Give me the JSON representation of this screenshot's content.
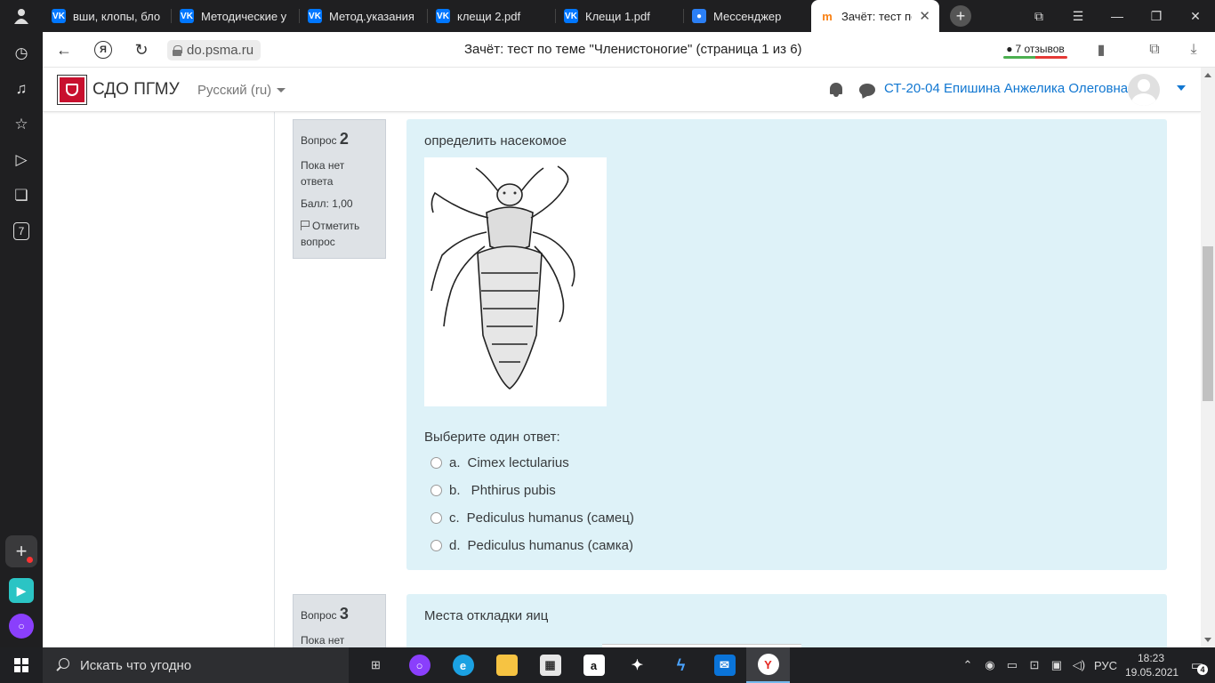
{
  "browser": {
    "tabs": [
      {
        "title": "вши, клопы, бло",
        "icon": "vk-icon",
        "active": false
      },
      {
        "title": "Методические у",
        "icon": "vk-icon",
        "active": false
      },
      {
        "title": "Метод.указания",
        "icon": "vk-icon",
        "active": false
      },
      {
        "title": "клещи 2.pdf",
        "icon": "vk-icon",
        "active": false
      },
      {
        "title": "Клещи 1.pdf",
        "icon": "vk-icon",
        "active": false
      },
      {
        "title": "Мессенджер",
        "icon": "messenger-icon",
        "active": false
      },
      {
        "title": "Зачёт: тест по",
        "icon": "moodle-icon",
        "active": true
      }
    ],
    "url": "do.psma.ru",
    "page_title": "Зачёт: тест по теме \"Членистоногие\" (страница 1 из 6)",
    "reviews_label": "7 отзывов",
    "sidebar_badge": "7"
  },
  "moodle": {
    "site_name": "СДО ПГМУ",
    "language": "Русский (ru)",
    "user_name": "СТ-20-04 Епишина Анжелика Олеговна"
  },
  "questions": [
    {
      "label": "Вопрос",
      "number": "2",
      "status": "Пока нет ответа",
      "grade": "Балл: 1,00",
      "flag_label": "Отметить вопрос",
      "text": "определить насекомое",
      "prompt": "Выберите один ответ:",
      "options": [
        {
          "letter": "a.",
          "text": "Cimex lectularius"
        },
        {
          "letter": "b.",
          "text": " Phthirus pubis"
        },
        {
          "letter": "c.",
          "text": "Pediculus humanus (самец)"
        },
        {
          "letter": "d.",
          "text": "Pediculus humanus (самка)"
        }
      ]
    },
    {
      "label": "Вопрос",
      "number": "3",
      "status": "Пока нет ответа",
      "text": "Места откладки яиц"
    }
  ],
  "taskbar": {
    "search_placeholder": "Искать что угодно",
    "language": "РУС",
    "time": "18:23",
    "date": "19.05.2021",
    "notifications": "4"
  },
  "colors": {
    "accent": "#1177d1",
    "question_bg": "#def2f8",
    "info_bg": "#dee2e6",
    "chrome_dark": "#1f1f21"
  }
}
